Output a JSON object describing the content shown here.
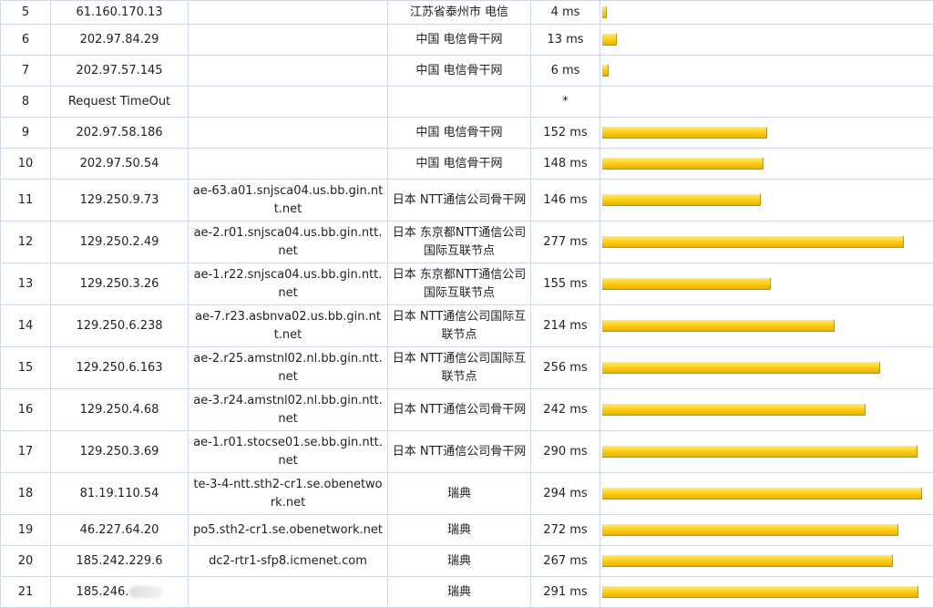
{
  "max_ms": 300,
  "hops": [
    {
      "hop": "5",
      "ip": "61.160.170.13",
      "host": "",
      "loc": "江苏省泰州市 电信",
      "ms": "4 ms",
      "latency": 4
    },
    {
      "hop": "6",
      "ip": "202.97.84.29",
      "host": "",
      "loc": "中国 电信骨干网",
      "ms": "13 ms",
      "latency": 13
    },
    {
      "hop": "7",
      "ip": "202.97.57.145",
      "host": "",
      "loc": "中国 电信骨干网",
      "ms": "6 ms",
      "latency": 6
    },
    {
      "hop": "8",
      "ip": "Request TimeOut",
      "host": "",
      "loc": "",
      "ms": "*",
      "latency": null
    },
    {
      "hop": "9",
      "ip": "202.97.58.186",
      "host": "",
      "loc": "中国 电信骨干网",
      "ms": "152 ms",
      "latency": 152
    },
    {
      "hop": "10",
      "ip": "202.97.50.54",
      "host": "",
      "loc": "中国 电信骨干网",
      "ms": "148 ms",
      "latency": 148
    },
    {
      "hop": "11",
      "ip": "129.250.9.73",
      "host": "ae-63.a01.snjsca04.us.bb.gin.ntt.net",
      "loc": "日本 NTT通信公司骨干网",
      "ms": "146 ms",
      "latency": 146
    },
    {
      "hop": "12",
      "ip": "129.250.2.49",
      "host": "ae-2.r01.snjsca04.us.bb.gin.ntt.net",
      "loc": "日本 东京都NTT通信公司国际互联节点",
      "ms": "277 ms",
      "latency": 277
    },
    {
      "hop": "13",
      "ip": "129.250.3.26",
      "host": "ae-1.r22.snjsca04.us.bb.gin.ntt.net",
      "loc": "日本 东京都NTT通信公司国际互联节点",
      "ms": "155 ms",
      "latency": 155
    },
    {
      "hop": "14",
      "ip": "129.250.6.238",
      "host": "ae-7.r23.asbnva02.us.bb.gin.ntt.net",
      "loc": "日本 NTT通信公司国际互联节点",
      "ms": "214 ms",
      "latency": 214
    },
    {
      "hop": "15",
      "ip": "129.250.6.163",
      "host": "ae-2.r25.amstnl02.nl.bb.gin.ntt.net",
      "loc": "日本 NTT通信公司国际互联节点",
      "ms": "256 ms",
      "latency": 256
    },
    {
      "hop": "16",
      "ip": "129.250.4.68",
      "host": "ae-3.r24.amstnl02.nl.bb.gin.ntt.net",
      "loc": "日本 NTT通信公司骨干网",
      "ms": "242 ms",
      "latency": 242
    },
    {
      "hop": "17",
      "ip": "129.250.3.69",
      "host": "ae-1.r01.stocse01.se.bb.gin.ntt.net",
      "loc": "日本 NTT通信公司骨干网",
      "ms": "290 ms",
      "latency": 290
    },
    {
      "hop": "18",
      "ip": "81.19.110.54",
      "host": "te-3-4-ntt.sth2-cr1.se.obenetwork.net",
      "loc": "瑞典",
      "ms": "294 ms",
      "latency": 294
    },
    {
      "hop": "19",
      "ip": "46.227.64.20",
      "host": "po5.sth2-cr1.se.obenetwork.net",
      "loc": "瑞典",
      "ms": "272 ms",
      "latency": 272
    },
    {
      "hop": "20",
      "ip": "185.242.229.6",
      "host": "dc2-rtr1-sfp8.icmenet.com",
      "loc": "瑞典",
      "ms": "267 ms",
      "latency": 267
    },
    {
      "hop": "21",
      "ip": "185.246.",
      "host": "",
      "loc": "瑞典",
      "ms": "291 ms",
      "latency": 291,
      "ip_redacted": true
    }
  ]
}
